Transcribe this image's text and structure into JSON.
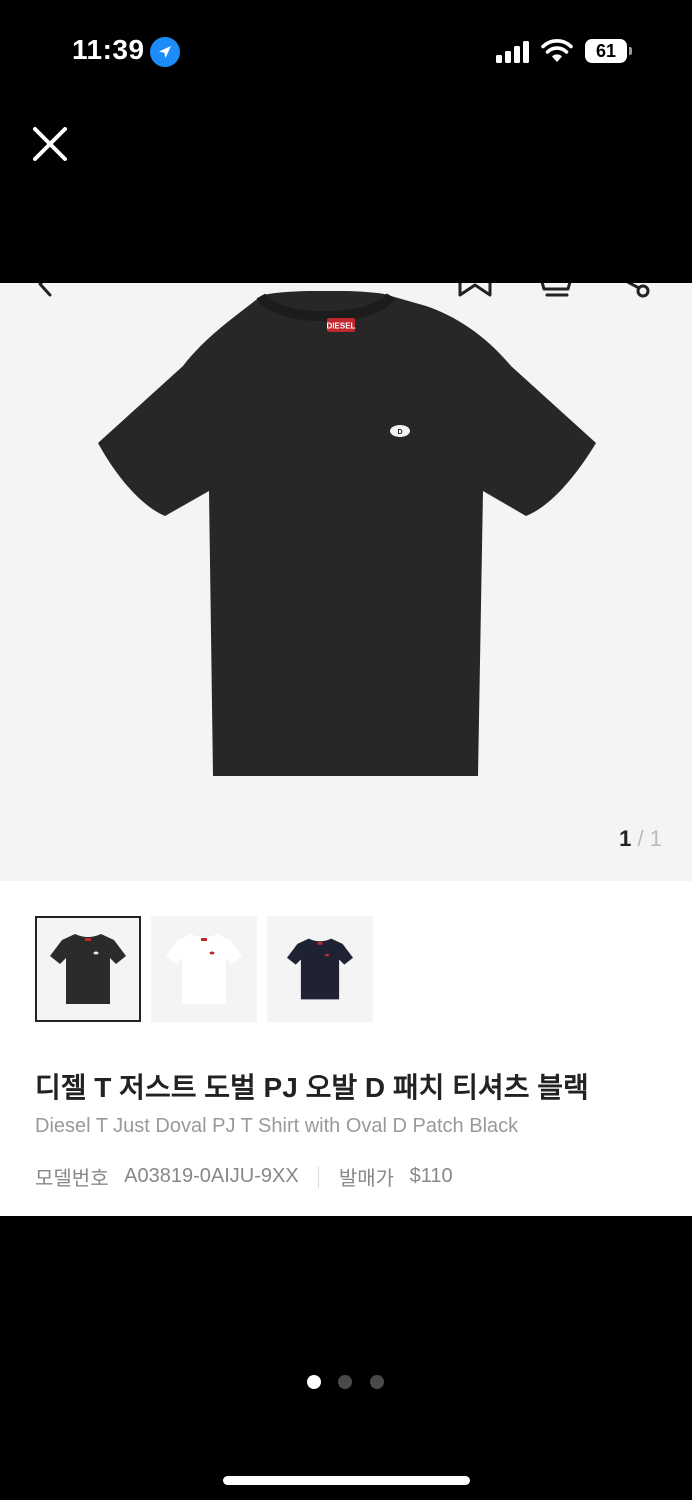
{
  "status_bar": {
    "time": "11:39",
    "battery": "61",
    "icons": [
      "location-arrow-icon",
      "cellular-signal-icon",
      "wifi-icon",
      "battery-icon"
    ]
  },
  "close_icon": "close-icon",
  "image_toolbar": {
    "icons": [
      "chevron-left-icon",
      "bookmark-icon",
      "cart-icon",
      "share-icon"
    ]
  },
  "gallery": {
    "current": "1",
    "separator": "/",
    "total": "1"
  },
  "thumbnails": [
    {
      "color": "#2b2b2b",
      "selected": true
    },
    {
      "color": "#ffffff",
      "selected": false
    },
    {
      "color": "#1e2233",
      "selected": false
    }
  ],
  "product": {
    "title_ko": "디젤 T 저스트 도벌 PJ 오발 D 패치 티셔츠 블랙",
    "title_en": "Diesel T Just Doval PJ T Shirt with Oval D Patch Black",
    "model_label": "모델번호",
    "model_value": "A03819-0AIJU-9XX",
    "price_label": "발매가",
    "price_value": "$110"
  },
  "page_dots": {
    "count": 3,
    "active_index": 0
  }
}
